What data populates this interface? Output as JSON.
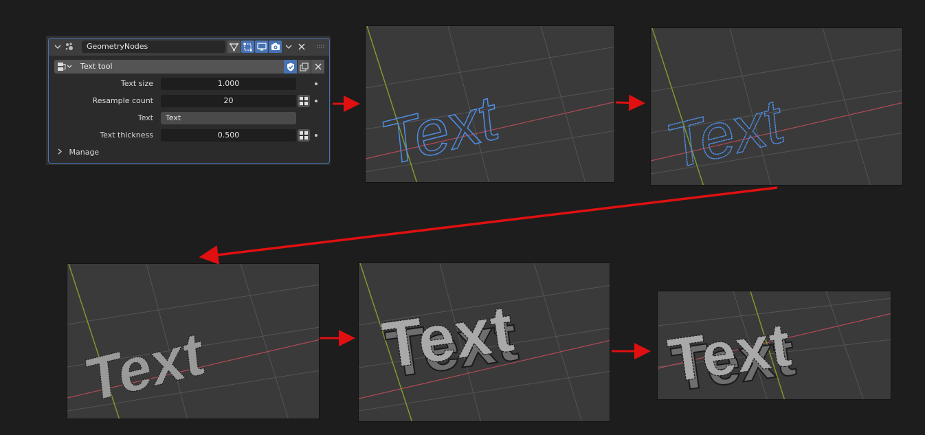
{
  "modifier": {
    "name": "GeometryNodes",
    "node_group": "Text tool",
    "manage_label": "Manage"
  },
  "properties": [
    {
      "label": "Text size",
      "value": "1.000"
    },
    {
      "label": "Resample count",
      "value": "20"
    },
    {
      "label": "Text",
      "value": "Text"
    },
    {
      "label": "Text thickness",
      "value": "0.500"
    }
  ],
  "viewports": [
    {
      "stage": "curve outline",
      "text": "Text",
      "style": "outline"
    },
    {
      "stage": "resampled curve",
      "text": "Text",
      "style": "outline"
    },
    {
      "stage": "filled mesh",
      "text": "Text",
      "style": "flat-mesh"
    },
    {
      "stage": "extruded mesh",
      "text": "Text",
      "style": "extruded"
    },
    {
      "stage": "extruded mesh close-up",
      "text": "Text",
      "style": "extruded"
    }
  ],
  "colors": {
    "accent": "#4772b3",
    "x_axis": "#b34a55",
    "y_axis": "#7f9a2a",
    "curve": "#4d8ee6",
    "arrow": "#e01010"
  },
  "icons": [
    "collapse-chevron-icon",
    "geometry-nodes-icon",
    "edit-mode-icon",
    "on-cage-icon",
    "realtime-icon",
    "render-icon",
    "extra-menu-icon",
    "delete-icon",
    "drag-handle-icon",
    "node-tree-icon",
    "fake-user-shield-icon",
    "duplicate-icon",
    "unlink-icon",
    "attribute-toggle-icon",
    "manage-chevron-icon"
  ]
}
